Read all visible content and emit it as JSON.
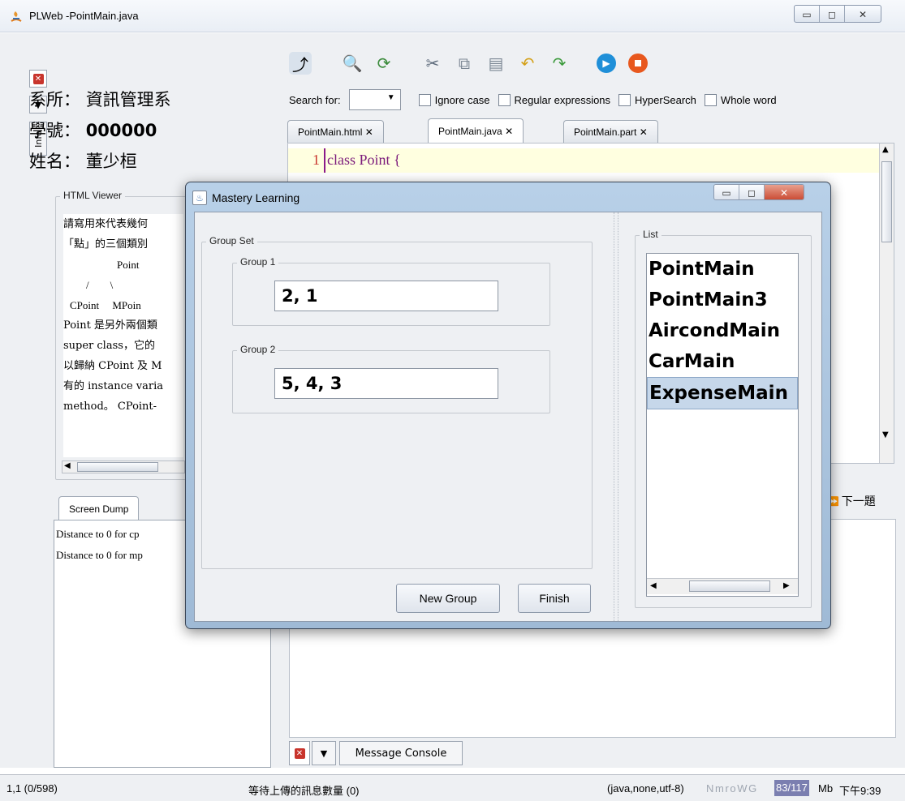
{
  "window": {
    "title": "PLWeb -PointMain.java"
  },
  "info_panel": {
    "dept_label": "系所：",
    "dept_value": "資訊管理系",
    "id_label": "學號：",
    "id_value": "000000",
    "name_label": "姓名：",
    "name_value": "董少桓",
    "info_tab": "Info"
  },
  "html_viewer": {
    "title": "HTML Viewer",
    "line1": "請寫用來代表幾何",
    "line2": "「點」的三個類別",
    "line3": "Point",
    "line4": "/        \\",
    "line5": "CPoint     MPoin",
    "line6": "Point 是另外兩個類",
    "line7": "super class，它的",
    "line8": "以歸納 CPoint 及 M",
    "line9": "有的 instance varia",
    "line10": "method。 CPoint- "
  },
  "screen_dump": {
    "tab": "Screen Dump",
    "line1": "Distance to 0 for cp",
    "line2": "Distance to 0 for mp"
  },
  "search": {
    "label": "Search for:",
    "ignore_case": "Ignore case",
    "regex": "Regular expressions",
    "hypersearch": "HyperSearch",
    "whole_word": "Whole word"
  },
  "editor_tabs": [
    {
      "label": "PointMain.html"
    },
    {
      "label": "PointMain.java"
    },
    {
      "label": "PointMain.part"
    }
  ],
  "editor": {
    "line_no": "1",
    "code": "class Point {"
  },
  "next_question": "下一題",
  "console": {
    "label": "Message Console"
  },
  "dialog": {
    "title": "Mastery Learning",
    "group_set_title": "Group Set",
    "groups": [
      {
        "title": "Group 1",
        "value": "2, 1"
      },
      {
        "title": "Group 2",
        "value": "5, 4, 3"
      }
    ],
    "new_group_label": "New Group",
    "finish_label": "Finish",
    "list_title": "List",
    "list_items": [
      "PointMain",
      "PointMain3",
      "AircondMain",
      "CarMain",
      "ExpenseMain"
    ],
    "selected_index": 4
  },
  "statusbar": {
    "position": "1,1 (0/598)",
    "queue": "等待上傳的訊息數量 (0)",
    "encoding": "(java,none,utf-8)",
    "flags": "N m r o W G",
    "memory": "83/117",
    "memory_unit": "Mb",
    "clock": "下午9:39"
  },
  "colors": {
    "accent": "#3a7fd0",
    "selection": "#c6d7ea",
    "line_highlight": "#ffffe0",
    "close_red": "#c8342c"
  }
}
